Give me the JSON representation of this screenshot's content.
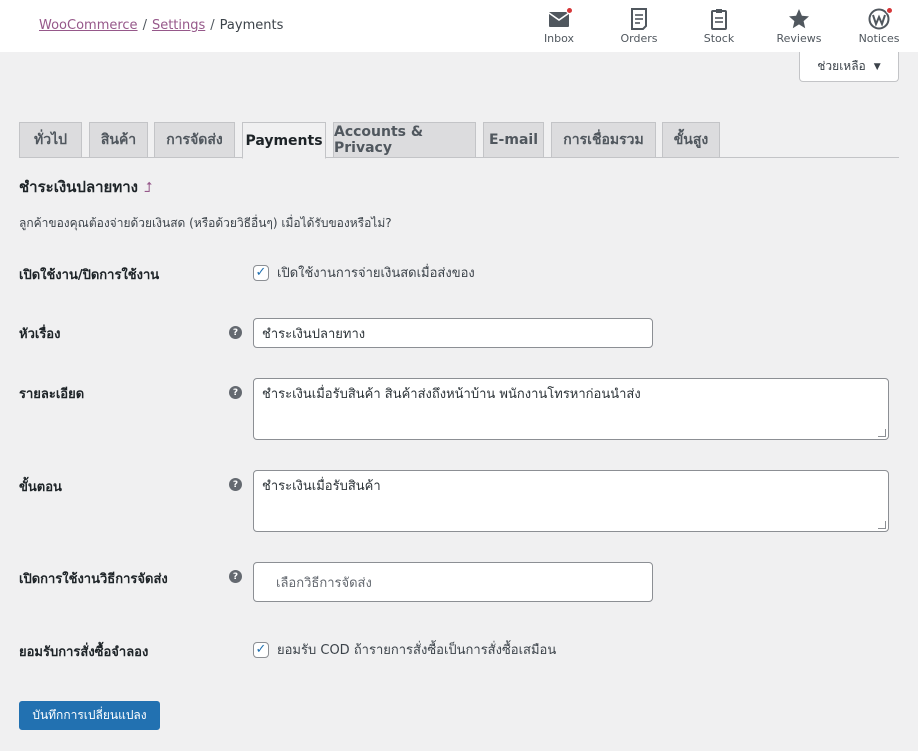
{
  "breadcrumb": {
    "woocommerce": "WooCommerce",
    "settings": "Settings",
    "current": "Payments",
    "sep": "/"
  },
  "activity": [
    {
      "label": "Inbox",
      "icon": "inbox-icon",
      "dot": true
    },
    {
      "label": "Orders",
      "icon": "orders-icon",
      "dot": false
    },
    {
      "label": "Stock",
      "icon": "stock-icon",
      "dot": false
    },
    {
      "label": "Reviews",
      "icon": "reviews-icon",
      "dot": false
    },
    {
      "label": "Notices",
      "icon": "notices-icon",
      "dot": true
    }
  ],
  "help_button": {
    "label": "ช่วยเหลือ",
    "caret": "▼"
  },
  "tabs": [
    {
      "label": "ทั่วไป"
    },
    {
      "label": "สินค้า"
    },
    {
      "label": "การจัดส่ง"
    },
    {
      "label": "Payments",
      "active": true
    },
    {
      "label": "Accounts & Privacy"
    },
    {
      "label": "E-mail"
    },
    {
      "label": "การเชื่อมรวม"
    },
    {
      "label": "ขั้นสูง"
    }
  ],
  "section": {
    "title": "ชำระเงินปลายทาง",
    "back_arrow": "⮥",
    "description": "ลูกค้าของคุณต้องจ่ายด้วยเงินสด (หรือด้วยวิธีอื่นๆ) เมื่อได้รับของหรือไม่?"
  },
  "fields": {
    "enable": {
      "label": "เปิดใช้งาน/ปิดการใช้งาน",
      "checkbox_label": "เปิดใช้งานการจ่ายเงินสดเมื่อส่งของ",
      "checked": true
    },
    "title": {
      "label": "หัวเรื่อง",
      "value": "ชำระเงินปลายทาง"
    },
    "description": {
      "label": "รายละเอียด",
      "value": "ชำระเงินเมื่อรับสินค้า  สินค้าส่งถึงหน้าบ้าน พนักงานโทรหาก่อนนำส่ง"
    },
    "instructions": {
      "label": "ขั้นตอน",
      "value": "ชำระเงินเมื่อรับสินค้า"
    },
    "shipping_methods": {
      "label": "เปิดการใช้งานวิธีการจัดส่ง",
      "placeholder": "เลือกวิธีการจัดส่ง"
    },
    "virtual_orders": {
      "label": "ยอมรับการสั่งซื้อจำลอง",
      "checkbox_label": "ยอมรับ COD ถ้ารายการสั่งซื้อเป็นการสั่งซื้อเสมือน",
      "checked": true
    }
  },
  "help_tip_glyph": "?",
  "check_glyph": "✓",
  "save_button": {
    "label": "บันทึกการเปลี่ยนแปลง"
  },
  "colors": {
    "accent": "#2271b1",
    "brand": "#96588a",
    "notify": "#d63638"
  }
}
